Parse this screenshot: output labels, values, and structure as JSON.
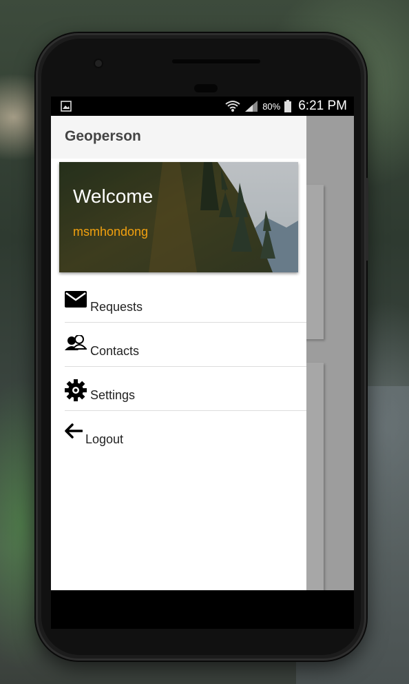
{
  "status_bar": {
    "battery_percent": "80%",
    "time": "6:21 PM",
    "left_icon": "image-notification-icon",
    "icons": [
      "wifi-icon",
      "signal-icon",
      "battery-icon"
    ]
  },
  "drawer": {
    "app_title": "Geoperson",
    "welcome": {
      "greeting": "Welcome",
      "username": "msmhondong"
    },
    "menu": [
      {
        "label": "Requests",
        "icon": "envelope-icon"
      },
      {
        "label": "Contacts",
        "icon": "contacts-icon"
      },
      {
        "label": "Settings",
        "icon": "gear-icon"
      },
      {
        "label": "Logout",
        "icon": "back-arrow-icon"
      }
    ]
  },
  "colors": {
    "username": "#f2a10f",
    "drawer_header": "#f5f5f5",
    "scrim": "#9e9e9e"
  }
}
